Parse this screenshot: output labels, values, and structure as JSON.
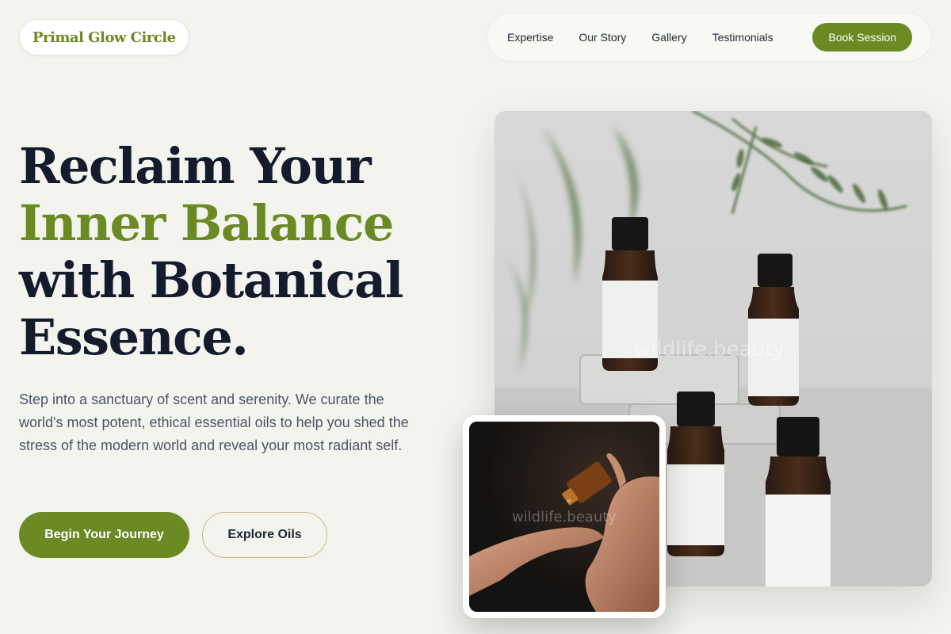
{
  "brand": {
    "name": "Primal Glow Circle"
  },
  "nav": {
    "links": [
      "Expertise",
      "Our Story",
      "Gallery",
      "Testimonials"
    ],
    "cta_label": "Book Session"
  },
  "hero": {
    "title_line1": "Reclaim Your",
    "title_line2": "Inner Balance",
    "title_line3": "with Botanical",
    "title_line4": "Essence.",
    "description": "Step into a sanctuary of scent and serenity. We curate the world's most potent, ethical essential oils to help you shed the stress of the modern world and reveal your most radiant self.",
    "primary_cta": "Begin Your Journey",
    "secondary_cta": "Explore Oils"
  },
  "images": {
    "main_watermark": "wildlife.beauty",
    "inset_watermark": "wildlife.beauty"
  },
  "colors": {
    "accent": "#6b8a23",
    "background": "#f4f4ef",
    "heading": "#141b2d",
    "body_text": "#4a5466",
    "outline_border": "#c9b98a"
  }
}
